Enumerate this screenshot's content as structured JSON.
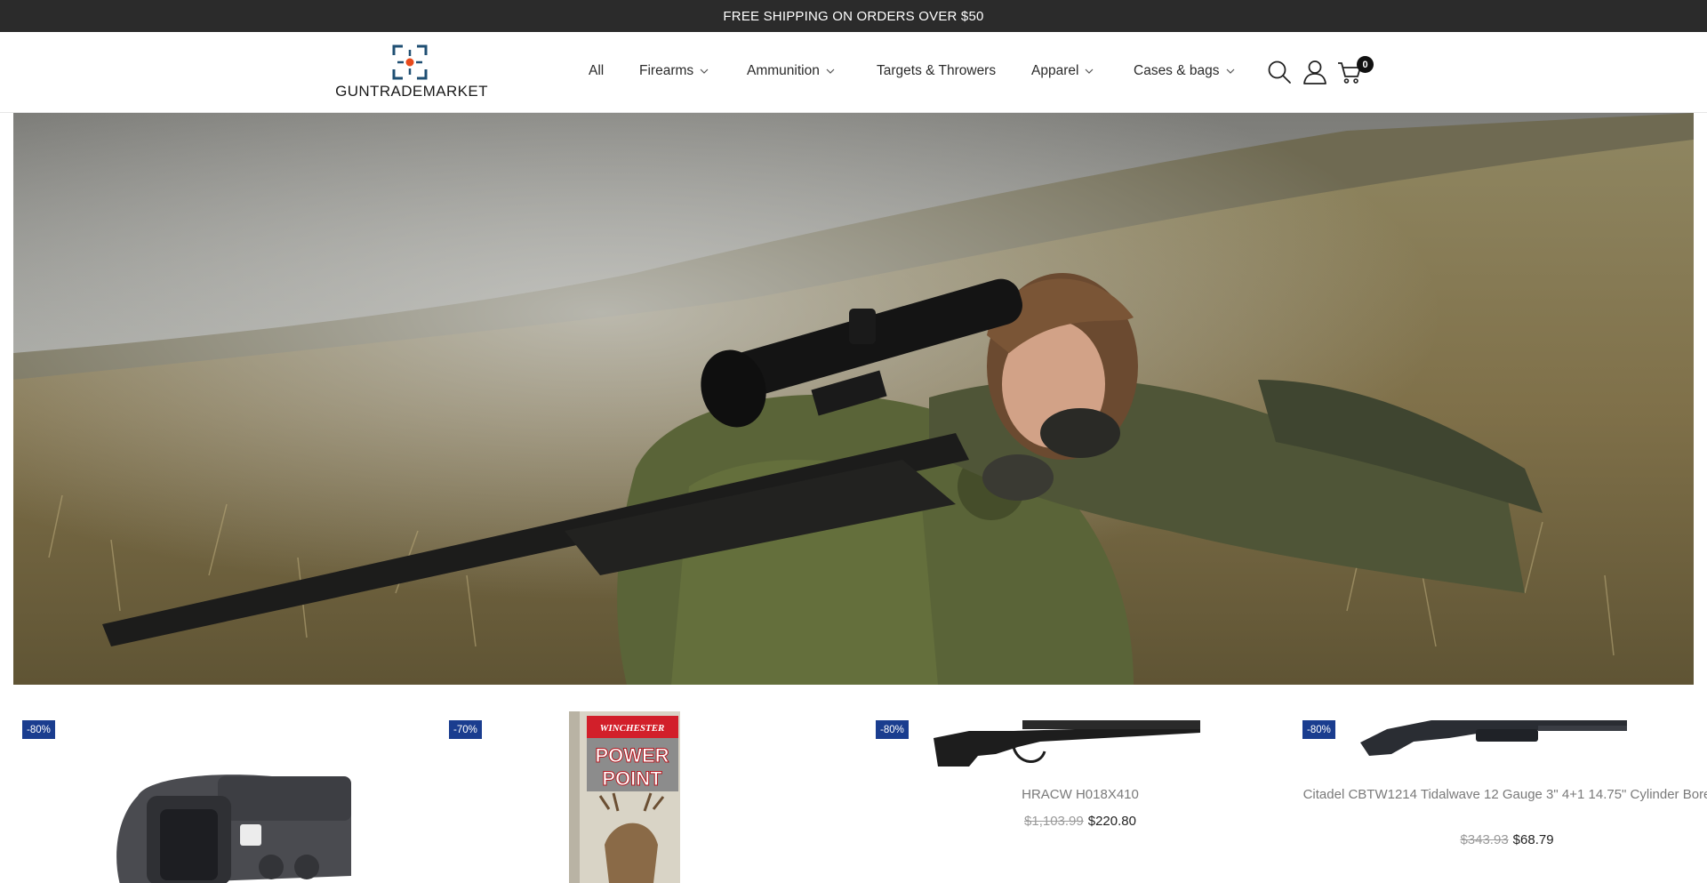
{
  "announcement": "FREE SHIPPING ON ORDERS OVER $50",
  "brand": {
    "name": "GUNTRADEMARKET",
    "accent": "#e84a1c",
    "mark_color": "#1f4f73"
  },
  "nav": {
    "all": "All",
    "firearms": "Firearms",
    "ammunition": "Ammunition",
    "targets": "Targets & Throwers",
    "apparel": "Apparel",
    "cases": "Cases & bags"
  },
  "header_icons": {
    "search": "search-icon",
    "account": "user-icon",
    "cart": "cart-icon",
    "cart_count": "0"
  },
  "hero": {
    "image": "hunter-with-scoped-rifle-in-grass"
  },
  "products": [
    {
      "badge": "-80%",
      "image": "red-dot-holographic-sight",
      "name": "",
      "old_price": "",
      "price": ""
    },
    {
      "badge": "-70%",
      "image": "winchester-power-point-ammo-box",
      "box_brand": "WINCHESTER",
      "box_title_1": "POWER",
      "box_title_2": "POINT",
      "name": "",
      "old_price": "",
      "price": ""
    },
    {
      "badge": "-80%",
      "image": "lever-action-rifle",
      "name": "HRACW H018X410",
      "old_price": "$1,103.99",
      "price": "$220.80"
    },
    {
      "badge": "-80%",
      "image": "pump-shotgun",
      "name": "Citadel CBTW1214 Tidalwave 12 Gauge 3\" 4+1 14.75\" Cylinder Bore",
      "old_price": "$343.93",
      "price": "$68.79"
    }
  ],
  "colors": {
    "badge_bg": "#1a3d8f",
    "announce_bg": "#2b2b2b"
  }
}
